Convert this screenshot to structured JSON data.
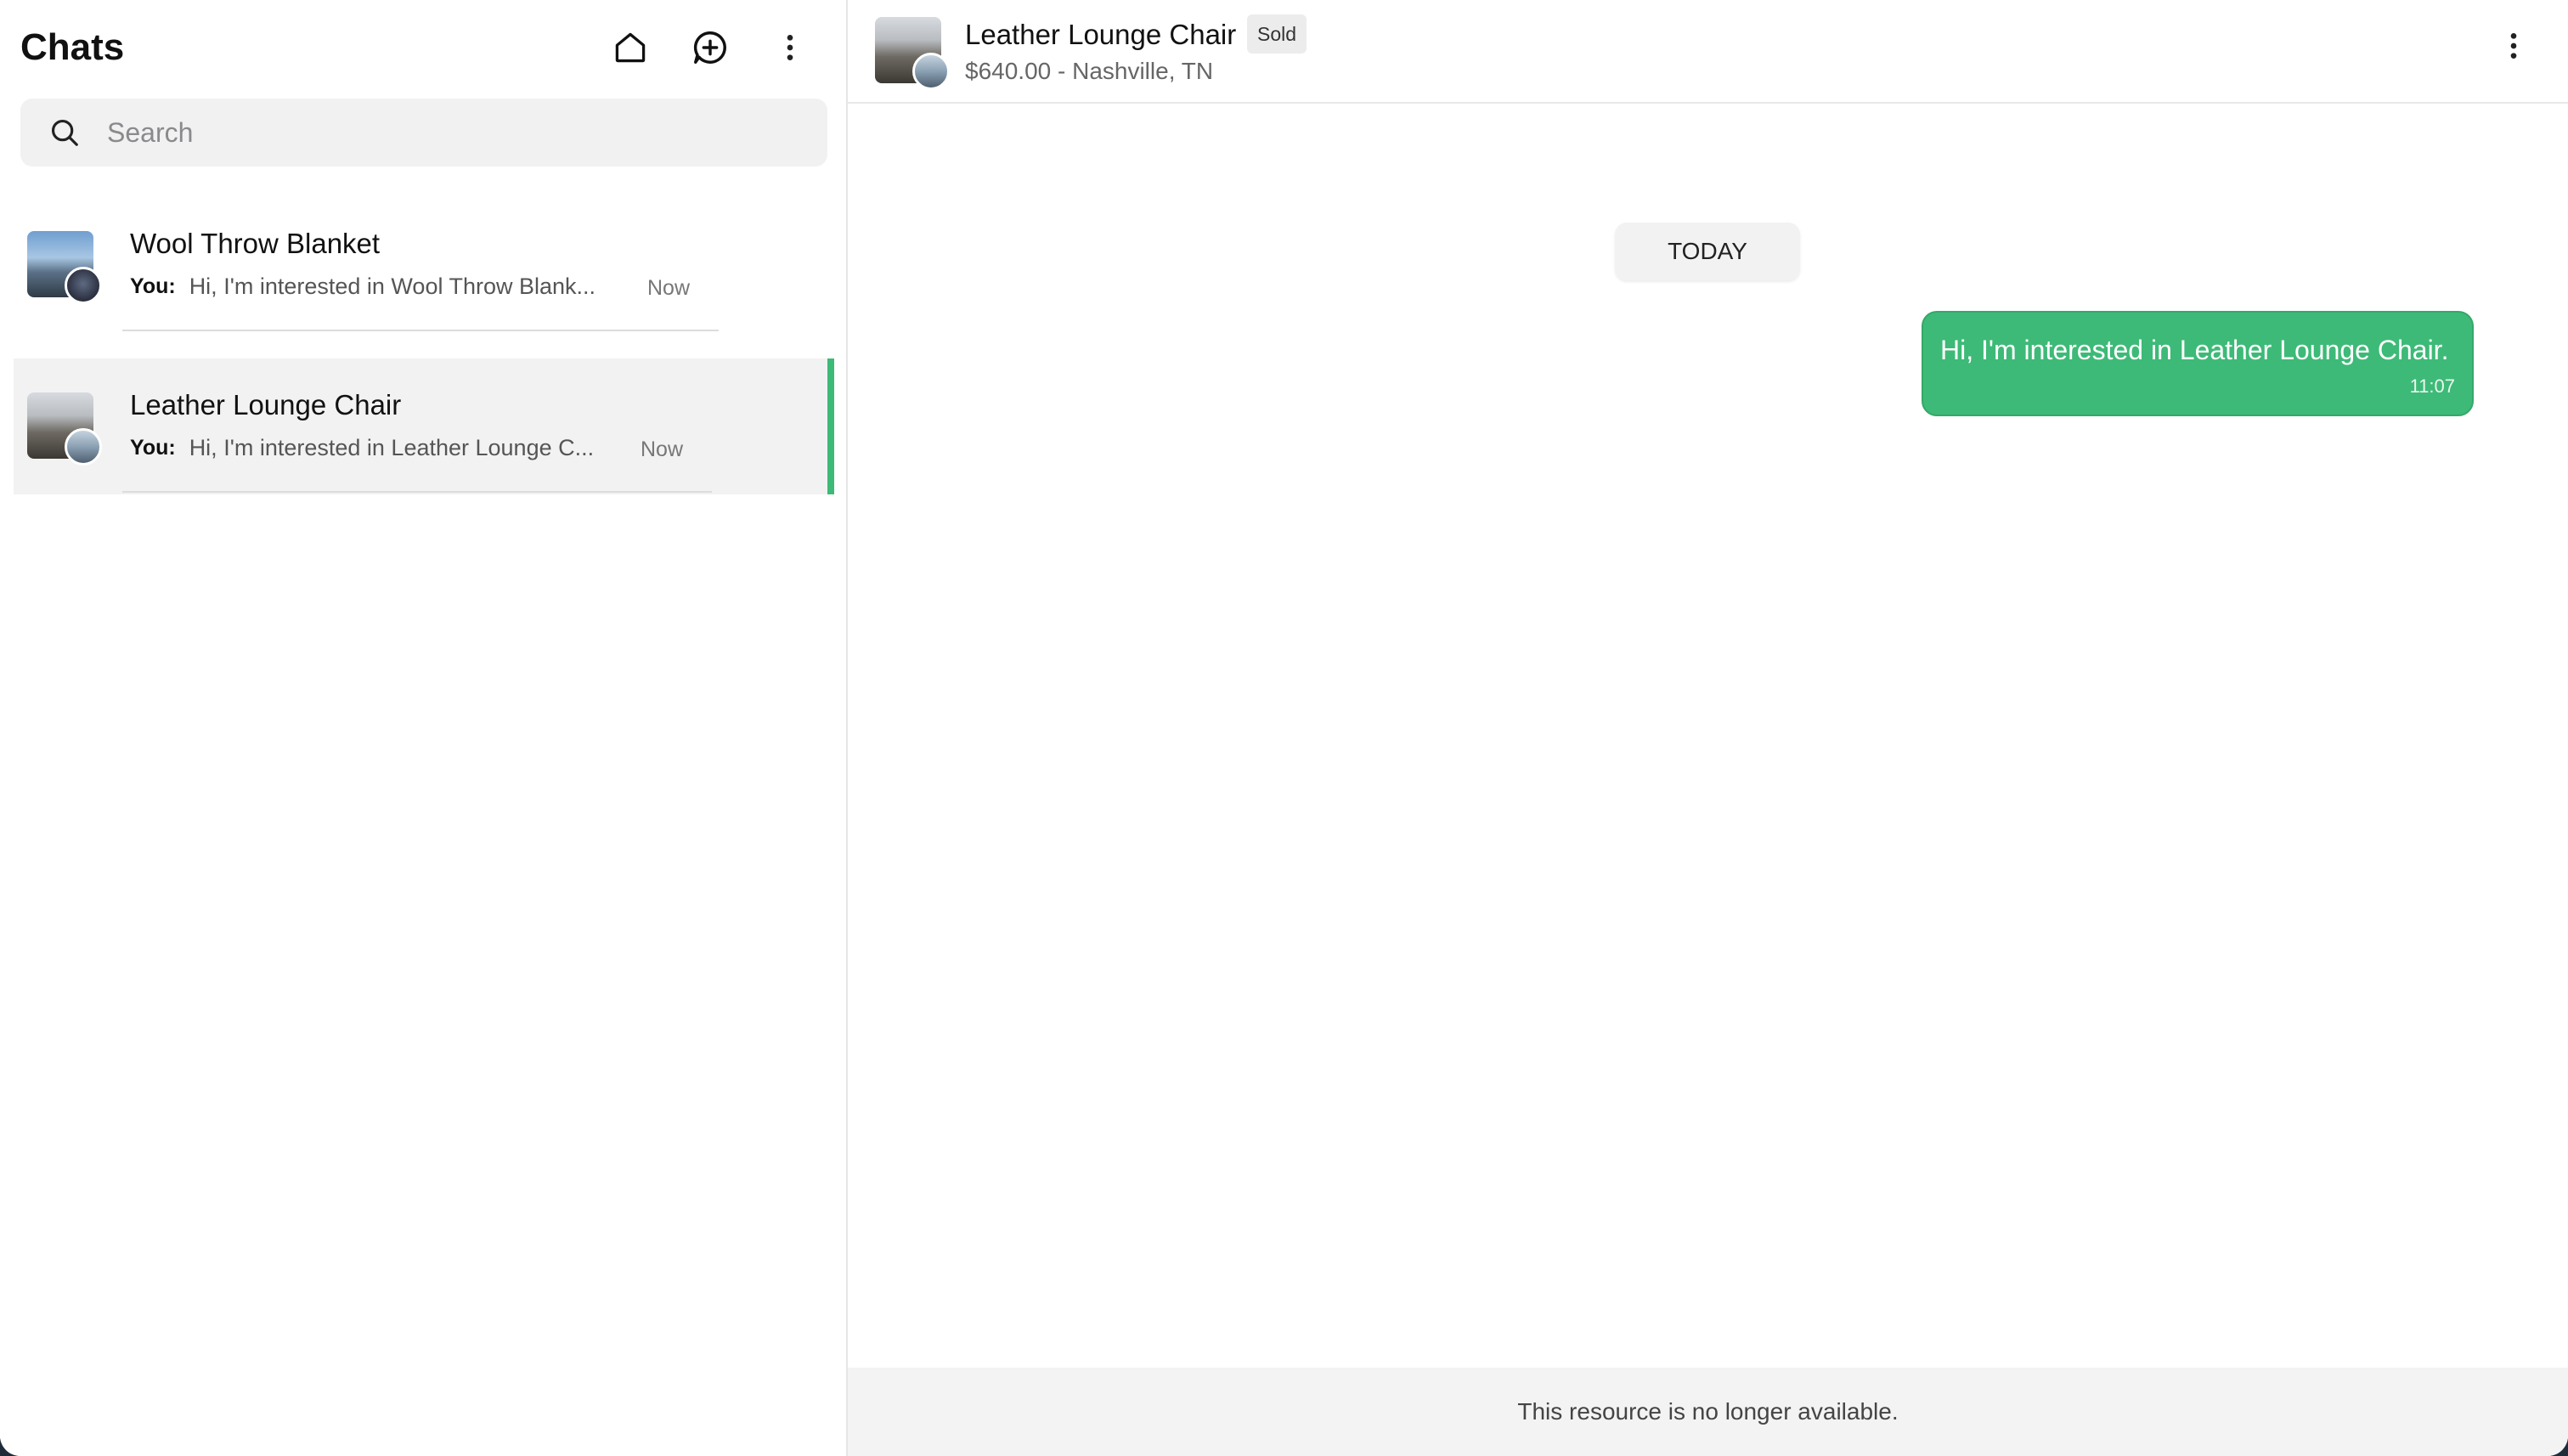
{
  "sidebar": {
    "title": "Chats",
    "search": {
      "placeholder": "Search",
      "value": ""
    },
    "chats": [
      {
        "name": "Wool Throw Blanket",
        "you_label": "You:",
        "preview": "Hi, I'm interested in Wool Throw Blank...",
        "time": "Now",
        "active": false
      },
      {
        "name": "Leather Lounge Chair",
        "you_label": "You:",
        "preview": "Hi, I'm interested in Leather Lounge C...",
        "time": "Now",
        "active": true
      }
    ],
    "icons": [
      "home-icon",
      "new-chat-icon",
      "more-vertical-icon",
      "search-icon"
    ]
  },
  "conversation": {
    "title": "Leather Lounge Chair",
    "status_badge": "Sold",
    "subtitle": "$640.00 - Nashville, TN",
    "day_separator": "TODAY",
    "messages": [
      {
        "from": "me",
        "text": "Hi, I'm interested in Leather Lounge Chair.",
        "time": "11:07"
      }
    ],
    "footer_notice": "This resource is no longer available."
  },
  "colors": {
    "accent": "#3dba77",
    "panel": "#f3f3f3",
    "active_row": "#f2f2f2"
  }
}
